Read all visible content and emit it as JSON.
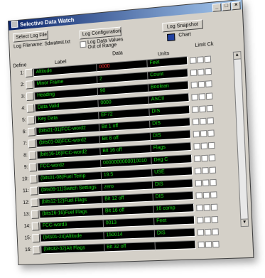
{
  "window": {
    "title": "Selective Data Watch",
    "buttons": [
      "_",
      "□",
      "×"
    ]
  },
  "toolbar": {
    "select_log_file": "Select Log File",
    "log_configuration": "Log Configuration",
    "log_snapshot": "Log Snapshot",
    "log_filename_label": "Log Filename:",
    "log_filename_value": "Sdwatest.txt",
    "log_out_of_range": "Log Data Values Out of Range",
    "chart_label": "Chart",
    "define_label": "Define",
    "limit_label": "Limit Ck"
  },
  "headers": {
    "label": "Label",
    "data": "Data",
    "units": "Units"
  },
  "rows": [
    {
      "num": "1:",
      "label": "Altitude",
      "data": "0000",
      "units": "Feet",
      "data_red": true
    },
    {
      "num": "2:",
      "label": "Minor Frame",
      "data": "2",
      "units": "Count"
    },
    {
      "num": "3:",
      "label": "Heading",
      "data": "90",
      "units": "Boolean"
    },
    {
      "num": "4:",
      "label": "Data Valid",
      "data": "0000",
      "units": "ASCII"
    },
    {
      "num": "5:",
      "label": "Key Data",
      "data": "EF72",
      "units": "DIS"
    },
    {
      "num": "6:",
      "label": "(bits01-01)FCC-word2",
      "data": "Bit 1 off",
      "units": "DIS"
    },
    {
      "num": "7:",
      "label": "(bits01-08)FCC-word2",
      "data": "Bit 8 off",
      "units": "DIS"
    },
    {
      "num": "8:",
      "label": "(bits16-16)FCC-word2",
      "data": "Bit 16 off",
      "units": "Flags"
    },
    {
      "num": "9:",
      "label": "FCC-word2",
      "data": "0000000000010010",
      "units": "Deg C"
    },
    {
      "num": "10:",
      "label": "(bits01-08)Fuel Temp",
      "data": "19.5",
      "units": "USE"
    },
    {
      "num": "11:",
      "label": "(bits09-11)Switch Settings",
      "data": "zero",
      "units": "DIS"
    },
    {
      "num": "12:",
      "label": "(bits12-12)Fuel Flags",
      "data": "Bit 12 off",
      "units": "DIS"
    },
    {
      "num": "13:",
      "label": "(bits16-16)Fuel Flags",
      "data": "Bit 16 off",
      "units": "16 comp"
    },
    {
      "num": "14:",
      "label": "FCC-word3",
      "data": "0013",
      "units": "Feet"
    },
    {
      "num": "15:",
      "label": "(bits01-24)Altitude",
      "data": "150014",
      "units": "DIS"
    },
    {
      "num": "16:",
      "label": "(bits32-32)Alt Flags",
      "data": "Bit 32 off",
      "units": ""
    }
  ],
  "colors": {
    "field_bg": "#000000",
    "field_text": "#19e019",
    "alert_text": "#ff3030",
    "titlebar": "#0a246a"
  }
}
